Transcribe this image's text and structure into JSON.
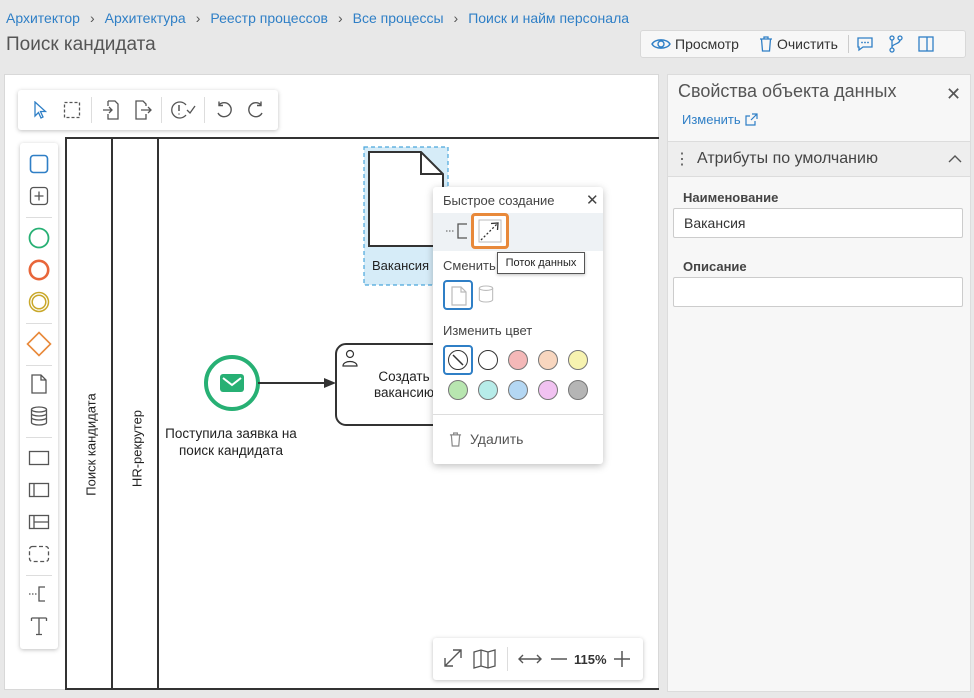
{
  "breadcrumb": [
    "Архитектор",
    "Архитектура",
    "Реестр процессов",
    "Все процессы",
    "Поиск и найм персонала"
  ],
  "page_title": "Поиск кандидата",
  "top_toolbar": {
    "view_label": "Просмотр",
    "clear_label": "Очистить"
  },
  "pool": {
    "title": "Поиск кандидата",
    "lane": "HR-рекрутер"
  },
  "diagram": {
    "start_event_label": "Поступила заявка на поиск кандидата",
    "task_label": "Создать вакансию",
    "data_object_label": "Вакансия"
  },
  "zoom": {
    "level": "115%"
  },
  "popup": {
    "quick_create": "Быстрое создание",
    "replace": "Сменить",
    "change_color": "Изменить цвет",
    "delete": "Удалить",
    "tooltip": "Поток данных",
    "colors": [
      "none",
      "#ffffff",
      "#f4b8b8",
      "#f8d6bf",
      "#f7f3b0",
      "#b8e6b0",
      "#b7ece9",
      "#b4d7f3",
      "#f1c2f1",
      "#b5b5b5"
    ]
  },
  "panel": {
    "title": "Свойства объекта данных",
    "edit_link": "Изменить",
    "section": "Атрибуты по умолчанию",
    "name_label": "Наименование",
    "name_value": "Вакансия",
    "description_label": "Описание",
    "description_value": ""
  },
  "accent": "#2f7fc6",
  "highlight": "#e8893a"
}
